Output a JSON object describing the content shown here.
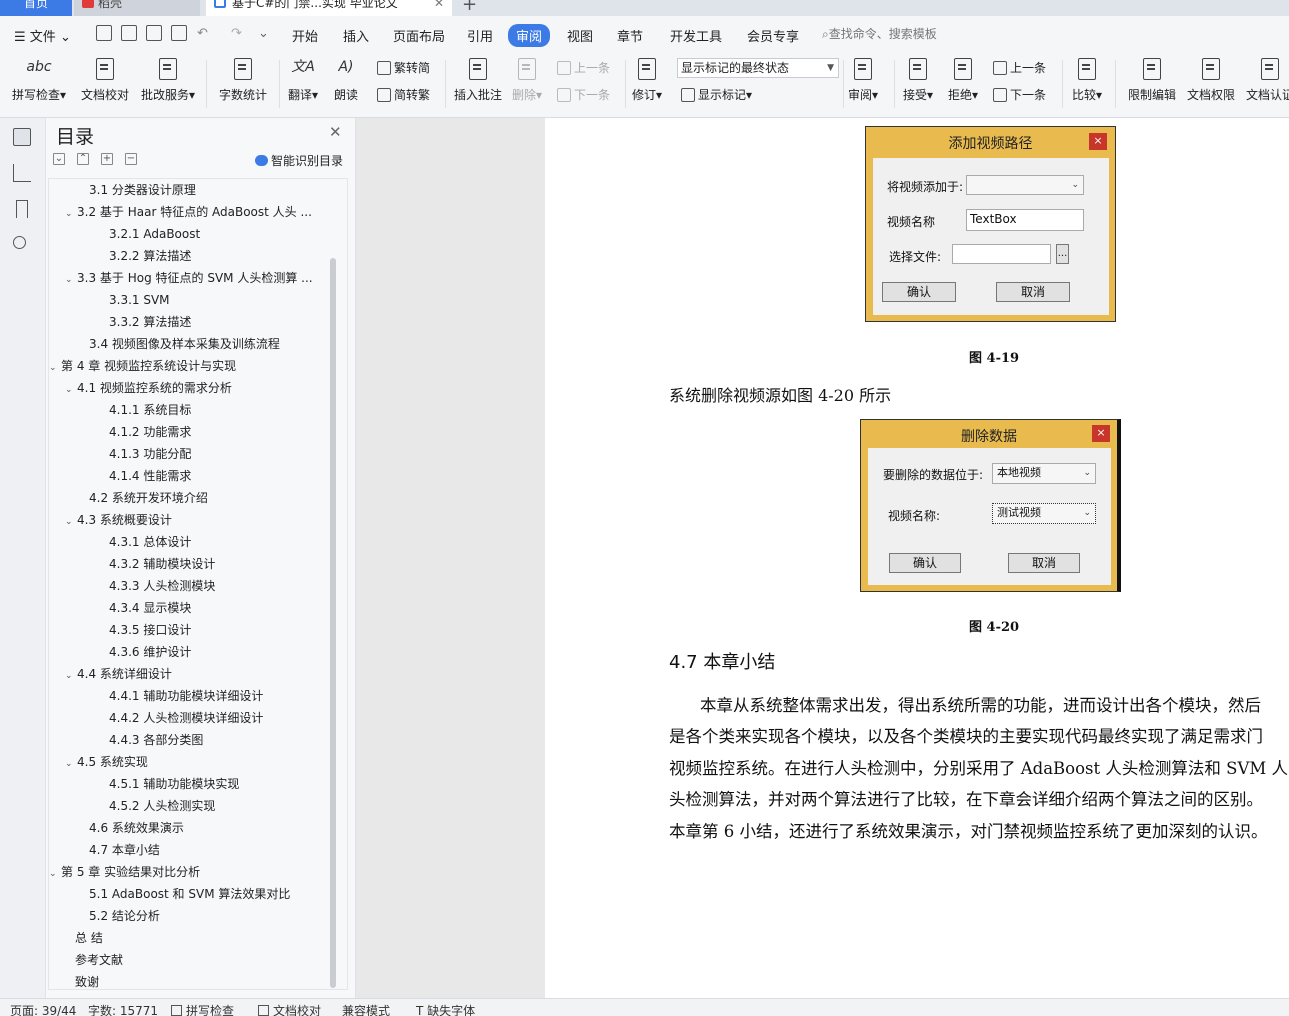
{
  "tabs": {
    "home": "首页",
    "draft": "稻壳",
    "doc": "基于C#的门禁...实现 毕业论文"
  },
  "menu": {
    "file": "文件",
    "items": [
      "开始",
      "插入",
      "页面布局",
      "引用",
      "审阅",
      "视图",
      "章节",
      "开发工具",
      "会员专享"
    ],
    "active": "审阅",
    "search_placeholder": "查找命令、搜索模板"
  },
  "toolbar": {
    "spell_check": "拼写检查",
    "doc_proof": "文档校对",
    "batch_service": "批改服务",
    "word_count": "字数统计",
    "translate": "翻译",
    "read_aloud": "朗读",
    "to_simplified": "繁转简",
    "to_traditional": "简转繁",
    "insert_comment": "插入批注",
    "delete": "删除",
    "prev": "上一条",
    "next": "下一条",
    "revise": "修订",
    "markup_state": "显示标记的最终状态",
    "show_markup": "显示标记",
    "review": "审阅",
    "accept": "接受",
    "reject": "拒绝",
    "prev2": "上一条",
    "next2": "下一条",
    "compare": "比较",
    "restrict_edit": "限制编辑",
    "doc_permission": "文档权限",
    "doc_cert": "文档认证"
  },
  "toc": {
    "title": "目录",
    "smart": "智能识别目录",
    "items": [
      {
        "text": "3.1  分类器设计原理",
        "level": 2,
        "chev": false
      },
      {
        "text": "3.2  基于 Haar 特征点的 AdaBoost 人头 ...",
        "level": 2,
        "chev": true
      },
      {
        "text": "3.2.1 AdaBoost",
        "level": 3,
        "chev": false
      },
      {
        "text": "3.2.2  算法描述",
        "level": 3,
        "chev": false
      },
      {
        "text": "3.3  基于 Hog 特征点的 SVM 人头检测算 ...",
        "level": 2,
        "chev": true
      },
      {
        "text": "3.3.1 SVM",
        "level": 3,
        "chev": false
      },
      {
        "text": "3.3.2  算法描述",
        "level": 3,
        "chev": false
      },
      {
        "text": "3.4  视频图像及样本采集及训练流程",
        "level": 2,
        "chev": false
      },
      {
        "text": "第 4 章   视频监控系统设计与实现",
        "level": 1,
        "chev": true
      },
      {
        "text": "4.1   视频监控系统的需求分析",
        "level": 2,
        "chev": true
      },
      {
        "text": "4.1.1  系统目标",
        "level": 3,
        "chev": false
      },
      {
        "text": "4.1.2  功能需求",
        "level": 3,
        "chev": false
      },
      {
        "text": "4.1.3  功能分配",
        "level": 3,
        "chev": false
      },
      {
        "text": "4.1.4  性能需求",
        "level": 3,
        "chev": false
      },
      {
        "text": "4.2  系统开发环境介绍",
        "level": 2,
        "chev": false
      },
      {
        "text": "4.3 系统概要设计",
        "level": 2,
        "chev": true
      },
      {
        "text": "4.3.1  总体设计",
        "level": 3,
        "chev": false
      },
      {
        "text": "4.3.2  辅助模块设计",
        "level": 3,
        "chev": false
      },
      {
        "text": "4.3.3  人头检测模块",
        "level": 3,
        "chev": false
      },
      {
        "text": "4.3.4  显示模块",
        "level": 3,
        "chev": false
      },
      {
        "text": "4.3.5  接口设计",
        "level": 3,
        "chev": false
      },
      {
        "text": "4.3.6 维护设计",
        "level": 3,
        "chev": false
      },
      {
        "text": "4.4  系统详细设计",
        "level": 2,
        "chev": true
      },
      {
        "text": "4.4.1  辅助功能模块详细设计",
        "level": 3,
        "chev": false
      },
      {
        "text": "4.4.2  人头检测模块详细设计",
        "level": 3,
        "chev": false
      },
      {
        "text": "4.4.3  各部分类图",
        "level": 3,
        "chev": false
      },
      {
        "text": "4.5  系统实现",
        "level": 2,
        "chev": true
      },
      {
        "text": "4.5.1  辅助功能模块实现",
        "level": 3,
        "chev": false
      },
      {
        "text": "4.5.2 人头检测实现",
        "level": 3,
        "chev": false
      },
      {
        "text": "4.6  系统效果演示",
        "level": 2,
        "chev": false
      },
      {
        "text": "4.7 本章小结",
        "level": 2,
        "chev": false
      },
      {
        "text": "第 5 章   实验结果对比分析",
        "level": 1,
        "chev": true
      },
      {
        "text": "5.1 AdaBoost 和 SVM 算法效果对比",
        "level": 2,
        "chev": false
      },
      {
        "text": "5.2 结论分析",
        "level": 2,
        "chev": false
      },
      {
        "text": "总  结",
        "level": 1,
        "chev": false
      },
      {
        "text": "参考文献",
        "level": 1,
        "chev": false
      },
      {
        "text": "致谢",
        "level": 1,
        "chev": false
      }
    ]
  },
  "doc": {
    "fig19": {
      "title": "添加视频路径",
      "label_add_to": "将视频添加于:",
      "label_name": "视频名称",
      "name_value": "TextBox",
      "label_file": "选择文件:",
      "browse": "...",
      "ok": "确认",
      "cancel": "取消",
      "caption": "图 4-19"
    },
    "intro_text": "系统删除视频源如图 4-20 所示",
    "fig20": {
      "title": "删除数据",
      "label_location": "要删除的数据位于:",
      "location_value": "本地视频",
      "label_name": "视频名称:",
      "name_value": "测试视频",
      "ok": "确认",
      "cancel": "取消",
      "caption": "图 4-20"
    },
    "heading": "4.7 本章小结",
    "lines": [
      "本章从系统整体需求出发，得出系统所需的功能，进而设计出各个模块，然后",
      "是各个类来实现各个模块，以及各个类模块的主要实现代码最终实现了满足需求门",
      "视频监控系统。在进行人头检测中，分别采用了 AdaBoost 人头检测算法和 SVM 人",
      "头检测算法，并对两个算法进行了比较，在下章会详细介绍两个算法之间的区别。",
      "本章第 6 小结，还进行了系统效果演示，对门禁视频监控系统了更加深刻的认识。"
    ]
  },
  "status": {
    "page": "页面: 39/44",
    "words": "字数: 15771",
    "spell": "拼写检查",
    "proof": "文档校对",
    "compat": "兼容模式",
    "missing_font": "缺失字体"
  },
  "colors": {
    "accent": "#3c7ae6",
    "dialog_frame": "#e9bb4e",
    "dialog_close": "#c8352b"
  }
}
